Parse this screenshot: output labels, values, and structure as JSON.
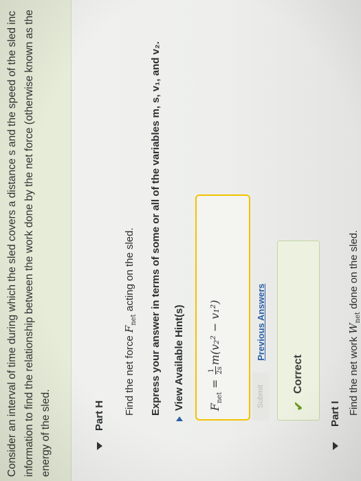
{
  "intro": {
    "line1": "Consider an interval of time during which the sled covers a distance s and the speed of the sled inc",
    "line2": "information to find the relationship between the work done by the net force (otherwise known as the",
    "line3": "energy of the sled."
  },
  "part_h": {
    "title": "Part H",
    "prompt_prefix": "Find the net force ",
    "prompt_var": "F",
    "prompt_sub": "net",
    "prompt_suffix": " acting on the sled.",
    "instruction": "Express your answer in terms of some or all of the variables m, s, v₁, and v₂.",
    "hints_label": "View Available Hint(s)",
    "answer": {
      "lhs": "F",
      "lhs_sub": "net",
      "equals": " = ",
      "frac_num": "1",
      "frac_den": "2s",
      "rhs": "m(v₂² − v₁²)"
    },
    "submit_label": "Submit",
    "previous_answers_label": "Previous Answers",
    "status_label": "Correct"
  },
  "part_i": {
    "title": "Part I",
    "prompt_prefix": "Find the net work ",
    "prompt_var": "W",
    "prompt_sub": "net",
    "prompt_suffix": " done on the sled."
  },
  "colors": {
    "banner": "#e6ecd8",
    "answer_border": "#f2c200",
    "link": "#2a5ea7",
    "correct_check": "#6c9a23"
  },
  "icons": {
    "part_h_toggle": "caret-down-icon",
    "hints_toggle": "caret-right-icon",
    "status": "checkmark-icon",
    "part_i_toggle": "caret-down-icon"
  }
}
